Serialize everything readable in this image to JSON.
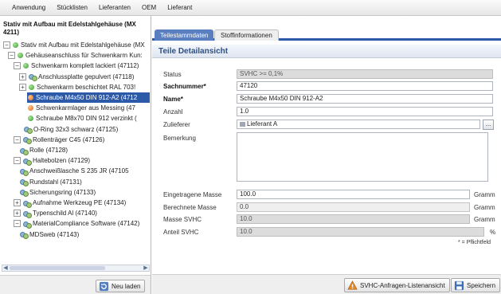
{
  "menubar": {
    "items": [
      "Anwendung",
      "Stücklisten",
      "Lieferanten",
      "OEM",
      "Lieferant"
    ]
  },
  "left": {
    "title": "Stativ mit Aufbau mit Edelstahlgehäuse (MX 4211)",
    "tree": [
      {
        "label": "Stativ mit Aufbau mit Edelstahlgehäuse (MX",
        "icon": "green-dot",
        "expander": "−"
      },
      {
        "label": "Gehäuseanschluss für Schwenkarm Kun:",
        "icon": "green-dot",
        "expander": "−"
      },
      {
        "label": "Schwenkarm komplett lackiert (47112)",
        "icon": "green-dot",
        "expander": "−"
      },
      {
        "label": "Anschlussplatte gepulvert (47118)",
        "icon": "material-icon",
        "expander": "+"
      },
      {
        "label": "Schwenkarm beschichtet RAL 703!",
        "icon": "green-dot",
        "expander": "+"
      },
      {
        "label": "Schraube M4x50 DIN 912-A2 (4712",
        "icon": "orange-dot",
        "expander": ""
      },
      {
        "label": "Schwenkarmlager aus Messing (47",
        "icon": "orange-dot",
        "expander": ""
      },
      {
        "label": "Schraube M8x70 DIN 912 verzinkt (",
        "icon": "green-dot",
        "expander": ""
      },
      {
        "label": "O-Ring 32x3 schwarz (47125)",
        "icon": "material-icon",
        "expander": ""
      },
      {
        "label": "Rollenträger C45 (47126)",
        "icon": "material-icon",
        "expander": "−"
      },
      {
        "label": "Rolle (47128)",
        "icon": "material-icon",
        "expander": ""
      },
      {
        "label": "Haltebolzen (47129)",
        "icon": "material-icon",
        "expander": "−"
      },
      {
        "label": "Anschweißlasche S 235 JR (47105",
        "icon": "material-icon",
        "expander": ""
      },
      {
        "label": "Rundstahl (47131)",
        "icon": "material-icon",
        "expander": ""
      },
      {
        "label": "Sicherungsring (47133)",
        "icon": "material-icon",
        "expander": ""
      },
      {
        "label": "Aufnahme Werkzeug PE (47134)",
        "icon": "material-icon",
        "expander": "+"
      },
      {
        "label": "Typenschild Al (47140)",
        "icon": "material-icon",
        "expander": "+"
      },
      {
        "label": "MaterialCompliance Software (47142)",
        "icon": "material-icon",
        "expander": "−"
      },
      {
        "label": "MDSweb (47143)",
        "icon": "material-icon",
        "expander": ""
      }
    ],
    "selected_index": 5,
    "reload_button": "Neu laden"
  },
  "right": {
    "tabs": [
      {
        "label": "Teilestammdaten",
        "active": true
      },
      {
        "label": "Stoffinformationen",
        "active": false
      }
    ],
    "section_title": "Teile Detailansicht",
    "fields": {
      "status": {
        "label": "Status",
        "value": "SVHC >= 0,1%"
      },
      "sachnummer": {
        "label": "Sachnummer*",
        "value": "47120"
      },
      "name": {
        "label": "Name*",
        "value": "Schraube M4x50 DIN 912-A2"
      },
      "anzahl": {
        "label": "Anzahl",
        "value": "1.0"
      },
      "zulieferer": {
        "label": "Zulieferer",
        "value": "Lieferant A",
        "button": "..."
      },
      "bemerkung": {
        "label": "Bemerkung",
        "value": ""
      },
      "eingetragene_masse": {
        "label": "Eingetragene Masse",
        "value": "100.0",
        "unit": "Gramm"
      },
      "berechnete_masse": {
        "label": "Berechnete Masse",
        "value": "0.0",
        "unit": "Gramm"
      },
      "masse_svhc": {
        "label": "Masse SVHC",
        "value": "10.0",
        "unit": "Gramm"
      },
      "anteil_svhc": {
        "label": "Anteil SVHC",
        "value": "10.0",
        "unit": "%"
      }
    },
    "footnote": "* = Pflichtfeld",
    "buttons": {
      "svhc_list": "SVHC-Anfragen-Listenansicht",
      "save": "Speichern"
    }
  },
  "colors": {
    "selection": "#2d5aa8",
    "section_title": "#2c4f86",
    "tab_active": "#5a7fc0"
  }
}
